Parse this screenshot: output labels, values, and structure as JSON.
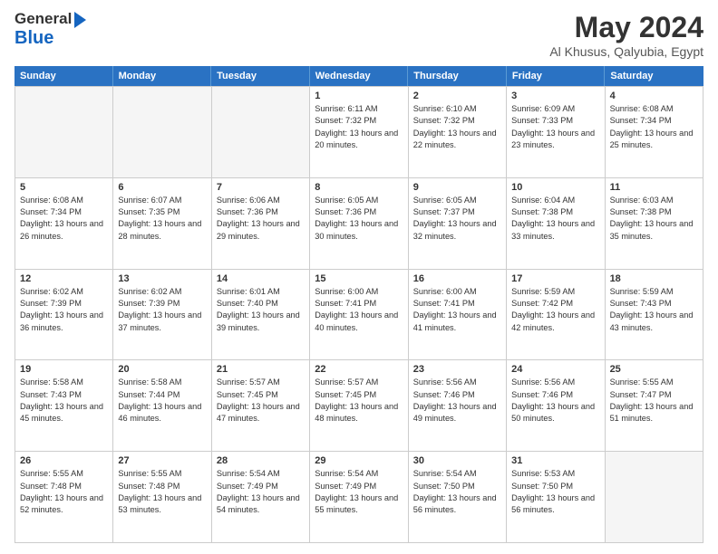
{
  "header": {
    "logo_line1": "General",
    "logo_line2": "Blue",
    "month": "May 2024",
    "location": "Al Khusus, Qalyubia, Egypt"
  },
  "calendar": {
    "days_of_week": [
      "Sunday",
      "Monday",
      "Tuesday",
      "Wednesday",
      "Thursday",
      "Friday",
      "Saturday"
    ],
    "weeks": [
      [
        {
          "day": "",
          "empty": true
        },
        {
          "day": "",
          "empty": true
        },
        {
          "day": "",
          "empty": true
        },
        {
          "day": "1",
          "sunrise": "Sunrise: 6:11 AM",
          "sunset": "Sunset: 7:32 PM",
          "daylight": "Daylight: 13 hours and 20 minutes."
        },
        {
          "day": "2",
          "sunrise": "Sunrise: 6:10 AM",
          "sunset": "Sunset: 7:32 PM",
          "daylight": "Daylight: 13 hours and 22 minutes."
        },
        {
          "day": "3",
          "sunrise": "Sunrise: 6:09 AM",
          "sunset": "Sunset: 7:33 PM",
          "daylight": "Daylight: 13 hours and 23 minutes."
        },
        {
          "day": "4",
          "sunrise": "Sunrise: 6:08 AM",
          "sunset": "Sunset: 7:34 PM",
          "daylight": "Daylight: 13 hours and 25 minutes."
        }
      ],
      [
        {
          "day": "5",
          "sunrise": "Sunrise: 6:08 AM",
          "sunset": "Sunset: 7:34 PM",
          "daylight": "Daylight: 13 hours and 26 minutes."
        },
        {
          "day": "6",
          "sunrise": "Sunrise: 6:07 AM",
          "sunset": "Sunset: 7:35 PM",
          "daylight": "Daylight: 13 hours and 28 minutes."
        },
        {
          "day": "7",
          "sunrise": "Sunrise: 6:06 AM",
          "sunset": "Sunset: 7:36 PM",
          "daylight": "Daylight: 13 hours and 29 minutes."
        },
        {
          "day": "8",
          "sunrise": "Sunrise: 6:05 AM",
          "sunset": "Sunset: 7:36 PM",
          "daylight": "Daylight: 13 hours and 30 minutes."
        },
        {
          "day": "9",
          "sunrise": "Sunrise: 6:05 AM",
          "sunset": "Sunset: 7:37 PM",
          "daylight": "Daylight: 13 hours and 32 minutes."
        },
        {
          "day": "10",
          "sunrise": "Sunrise: 6:04 AM",
          "sunset": "Sunset: 7:38 PM",
          "daylight": "Daylight: 13 hours and 33 minutes."
        },
        {
          "day": "11",
          "sunrise": "Sunrise: 6:03 AM",
          "sunset": "Sunset: 7:38 PM",
          "daylight": "Daylight: 13 hours and 35 minutes."
        }
      ],
      [
        {
          "day": "12",
          "sunrise": "Sunrise: 6:02 AM",
          "sunset": "Sunset: 7:39 PM",
          "daylight": "Daylight: 13 hours and 36 minutes."
        },
        {
          "day": "13",
          "sunrise": "Sunrise: 6:02 AM",
          "sunset": "Sunset: 7:39 PM",
          "daylight": "Daylight: 13 hours and 37 minutes."
        },
        {
          "day": "14",
          "sunrise": "Sunrise: 6:01 AM",
          "sunset": "Sunset: 7:40 PM",
          "daylight": "Daylight: 13 hours and 39 minutes."
        },
        {
          "day": "15",
          "sunrise": "Sunrise: 6:00 AM",
          "sunset": "Sunset: 7:41 PM",
          "daylight": "Daylight: 13 hours and 40 minutes."
        },
        {
          "day": "16",
          "sunrise": "Sunrise: 6:00 AM",
          "sunset": "Sunset: 7:41 PM",
          "daylight": "Daylight: 13 hours and 41 minutes."
        },
        {
          "day": "17",
          "sunrise": "Sunrise: 5:59 AM",
          "sunset": "Sunset: 7:42 PM",
          "daylight": "Daylight: 13 hours and 42 minutes."
        },
        {
          "day": "18",
          "sunrise": "Sunrise: 5:59 AM",
          "sunset": "Sunset: 7:43 PM",
          "daylight": "Daylight: 13 hours and 43 minutes."
        }
      ],
      [
        {
          "day": "19",
          "sunrise": "Sunrise: 5:58 AM",
          "sunset": "Sunset: 7:43 PM",
          "daylight": "Daylight: 13 hours and 45 minutes."
        },
        {
          "day": "20",
          "sunrise": "Sunrise: 5:58 AM",
          "sunset": "Sunset: 7:44 PM",
          "daylight": "Daylight: 13 hours and 46 minutes."
        },
        {
          "day": "21",
          "sunrise": "Sunrise: 5:57 AM",
          "sunset": "Sunset: 7:45 PM",
          "daylight": "Daylight: 13 hours and 47 minutes."
        },
        {
          "day": "22",
          "sunrise": "Sunrise: 5:57 AM",
          "sunset": "Sunset: 7:45 PM",
          "daylight": "Daylight: 13 hours and 48 minutes."
        },
        {
          "day": "23",
          "sunrise": "Sunrise: 5:56 AM",
          "sunset": "Sunset: 7:46 PM",
          "daylight": "Daylight: 13 hours and 49 minutes."
        },
        {
          "day": "24",
          "sunrise": "Sunrise: 5:56 AM",
          "sunset": "Sunset: 7:46 PM",
          "daylight": "Daylight: 13 hours and 50 minutes."
        },
        {
          "day": "25",
          "sunrise": "Sunrise: 5:55 AM",
          "sunset": "Sunset: 7:47 PM",
          "daylight": "Daylight: 13 hours and 51 minutes."
        }
      ],
      [
        {
          "day": "26",
          "sunrise": "Sunrise: 5:55 AM",
          "sunset": "Sunset: 7:48 PM",
          "daylight": "Daylight: 13 hours and 52 minutes."
        },
        {
          "day": "27",
          "sunrise": "Sunrise: 5:55 AM",
          "sunset": "Sunset: 7:48 PM",
          "daylight": "Daylight: 13 hours and 53 minutes."
        },
        {
          "day": "28",
          "sunrise": "Sunrise: 5:54 AM",
          "sunset": "Sunset: 7:49 PM",
          "daylight": "Daylight: 13 hours and 54 minutes."
        },
        {
          "day": "29",
          "sunrise": "Sunrise: 5:54 AM",
          "sunset": "Sunset: 7:49 PM",
          "daylight": "Daylight: 13 hours and 55 minutes."
        },
        {
          "day": "30",
          "sunrise": "Sunrise: 5:54 AM",
          "sunset": "Sunset: 7:50 PM",
          "daylight": "Daylight: 13 hours and 56 minutes."
        },
        {
          "day": "31",
          "sunrise": "Sunrise: 5:53 AM",
          "sunset": "Sunset: 7:50 PM",
          "daylight": "Daylight: 13 hours and 56 minutes."
        },
        {
          "day": "",
          "empty": true
        }
      ]
    ]
  }
}
